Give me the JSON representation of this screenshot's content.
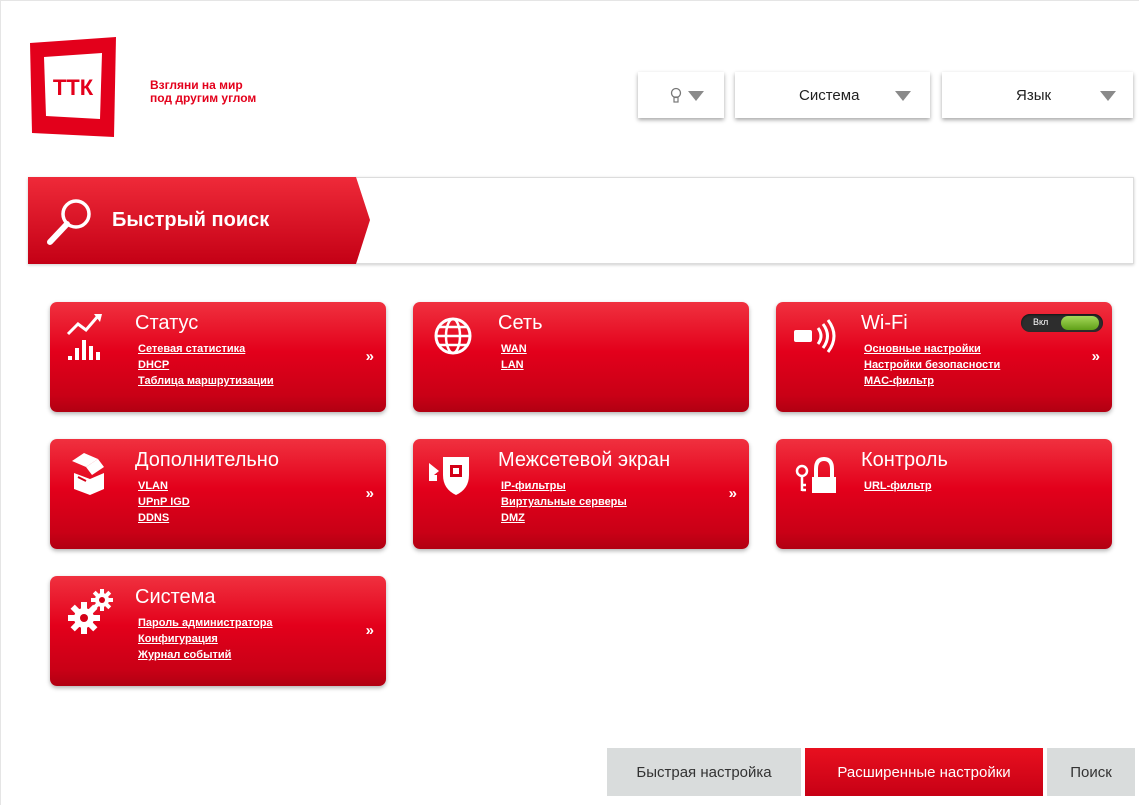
{
  "logo": {
    "brand": "ТТК",
    "tagline_line1": "Взгляни на мир",
    "tagline_line2": "под другим углом"
  },
  "top_bar": {
    "hint_icon": "lightbulb-icon",
    "system_label": "Система",
    "language_label": "Язык"
  },
  "quick_search": {
    "label": "Быстрый поиск",
    "icon": "search-icon"
  },
  "tiles": [
    {
      "title": "Статус",
      "icon": "statistics-icon",
      "links": [
        "Сетевая статистика",
        "DHCP",
        "Таблица маршрутизации"
      ],
      "arrow": "»"
    },
    {
      "title": "Сеть",
      "icon": "globe-icon",
      "links": [
        "WAN",
        "LAN"
      ],
      "arrow": ""
    },
    {
      "title": "Wi-Fi",
      "icon": "wifi-icon",
      "links": [
        "Основные настройки",
        "Настройки безопасности",
        "MAC-фильтр"
      ],
      "arrow": "»",
      "toggle_label": "Вкл"
    },
    {
      "title": "Дополнительно",
      "icon": "box-icon",
      "links": [
        "VLAN",
        "UPnP IGD",
        "DDNS"
      ],
      "arrow": "»"
    },
    {
      "title": "Межсетевой экран",
      "icon": "firewall-icon",
      "links": [
        "IP-фильтры",
        "Виртуальные серверы",
        "DMZ"
      ],
      "arrow": "»"
    },
    {
      "title": "Контроль",
      "icon": "lock-key-icon",
      "links": [
        "URL-фильтр"
      ],
      "arrow": ""
    },
    {
      "title": "Система",
      "icon": "gears-icon",
      "links": [
        "Пароль администратора",
        "Конфигурация",
        "Журнал событий"
      ],
      "arrow": "»"
    }
  ],
  "bottom_buttons": {
    "quick_setup": "Быстрая настройка",
    "advanced": "Расширенные настройки",
    "search": "Поиск"
  },
  "colors": {
    "accent": "#e3001b",
    "dark_accent": "#b10012",
    "toggle_on": "#7cc02e"
  }
}
